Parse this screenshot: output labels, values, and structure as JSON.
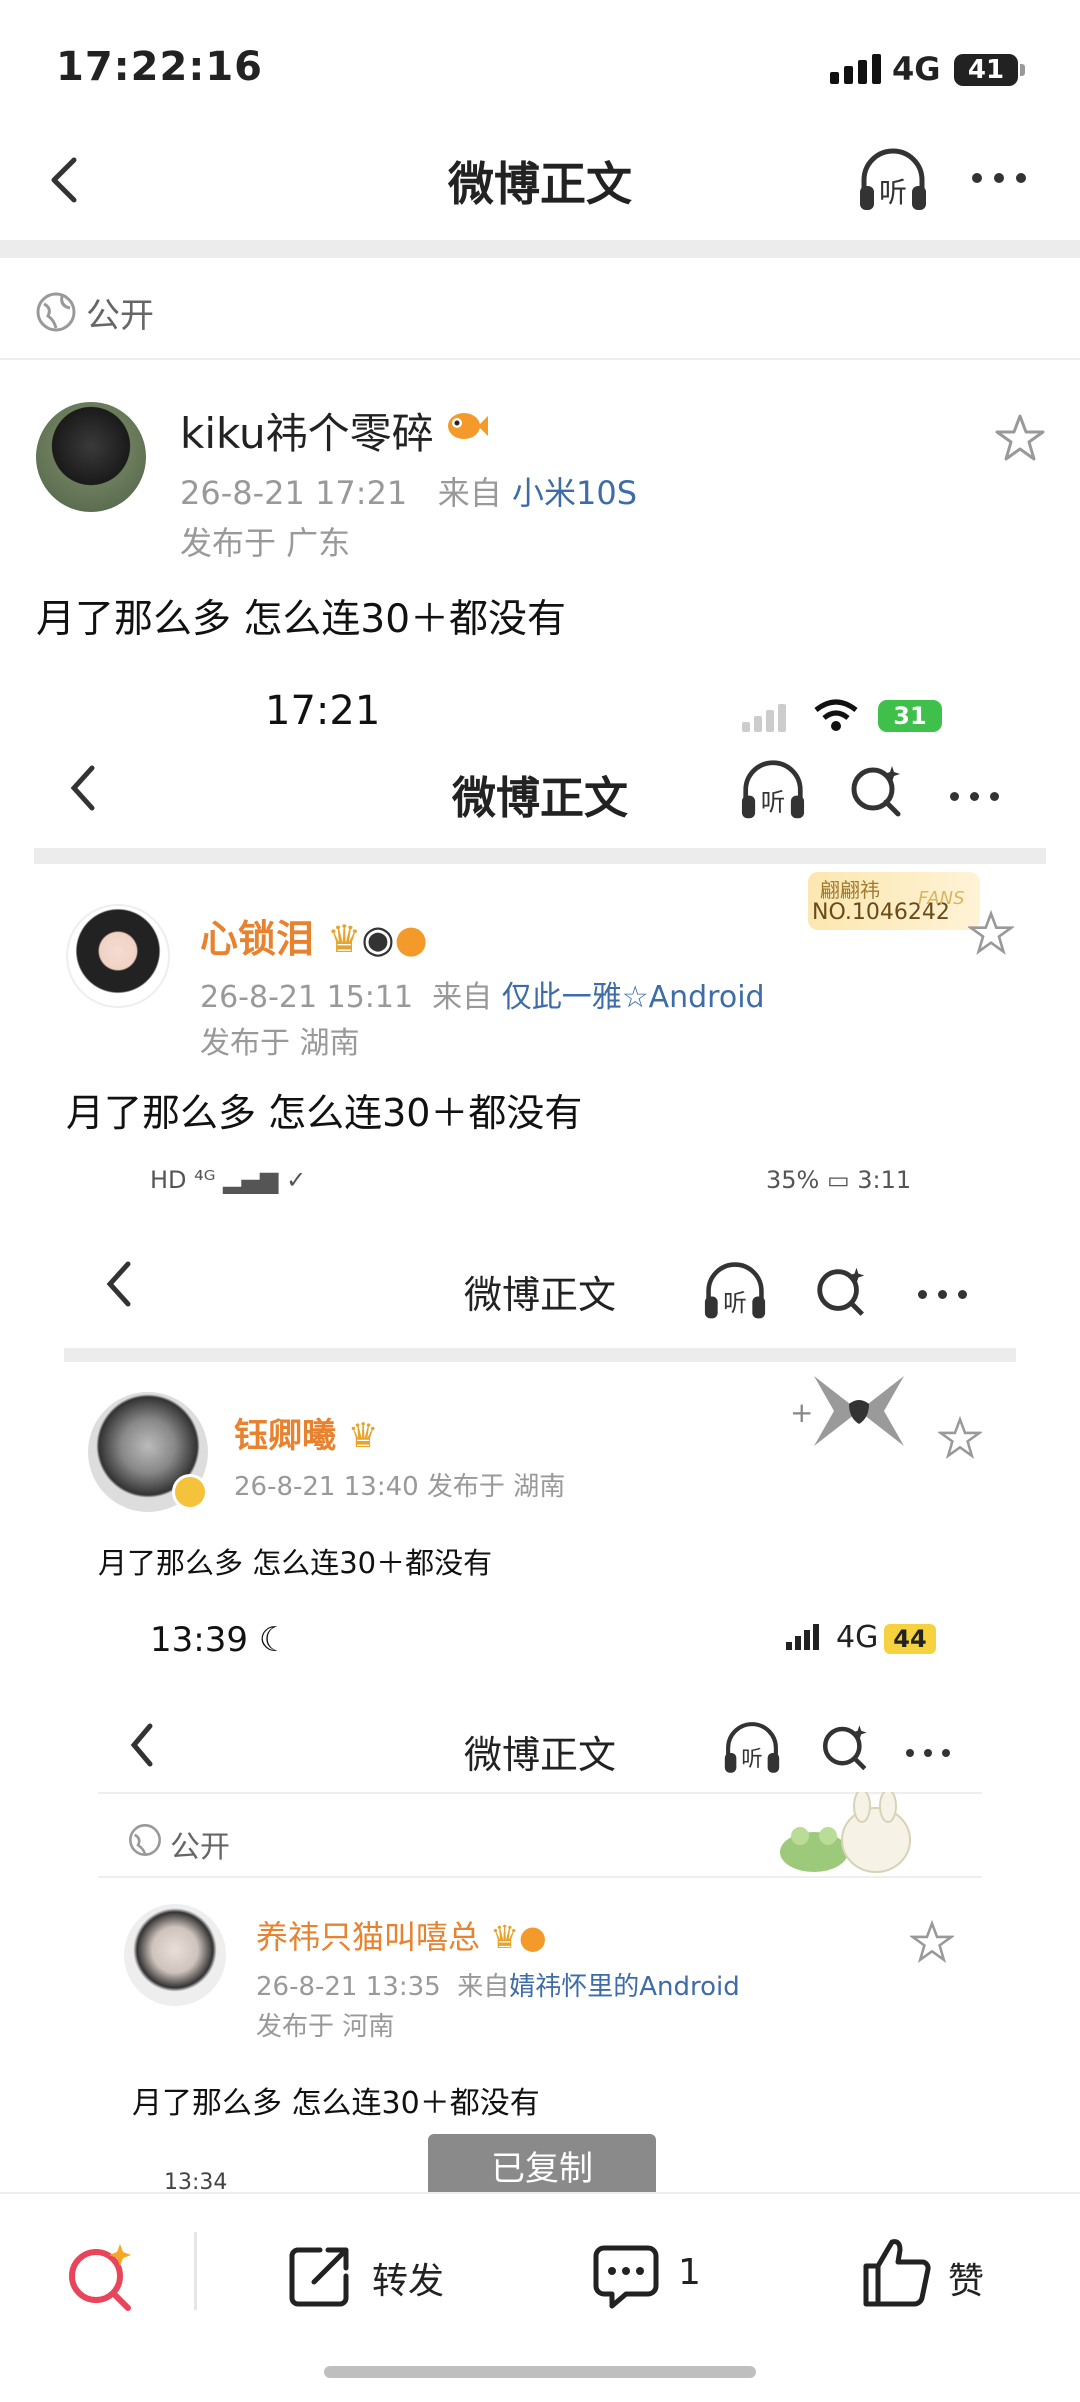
{
  "status_bar": {
    "time": "17:22:16",
    "network": "4G",
    "battery": "41"
  },
  "nav": {
    "title": "微博正文",
    "listen_label": "听"
  },
  "visibility": {
    "label": "公开"
  },
  "post": {
    "username": "kiku祎个零碎",
    "date": "26-8-21 17:21",
    "source_prefix": "来自",
    "source": "小米10S",
    "location": "发布于 广东",
    "text": "月了那么多 怎么连30＋都没有"
  },
  "embed1": {
    "status_time": "17:21",
    "battery": "31",
    "title": "微博正文",
    "listen_label": "听",
    "fans_badge_line1": "翩翩祎",
    "fans_badge_line2": "NO.1046242",
    "fans_badge_tag": "FANS",
    "username": "心锁泪",
    "date": "26-8-21 15:11",
    "source_prefix": "来自",
    "source": "仅此一雅☆Android",
    "location": "发布于 湖南",
    "text": "月了那么多 怎么连30＋都没有"
  },
  "embed2": {
    "status_left": "HD ⁴ᴳ",
    "battery_percent": "35%",
    "status_time": "3:11",
    "title": "微博正文",
    "listen_label": "听",
    "username": "钰卿曦",
    "meta": "26-8-21 13:40   发布于 湖南",
    "text": "月了那么多 怎么连30＋都没有"
  },
  "embed3": {
    "status_time": "13:39",
    "network": "4G",
    "battery": "44",
    "title": "微博正文",
    "listen_label": "听",
    "visibility": "公开",
    "username": "养祎只猫叫嘻总",
    "date": "26-8-21 13:35",
    "source_prefix": "来自",
    "source": "婧祎怀里的Android",
    "location": "发布于 河南",
    "text": "月了那么多 怎么连30＋都没有",
    "cut_time": "13:34"
  },
  "toast": {
    "text": "已复制"
  },
  "toolbar": {
    "repost": "转发",
    "comment_count": "1",
    "like": "赞"
  },
  "colors": {
    "link": "#3d6ca8",
    "vip_name": "#e8822e",
    "meta_gray": "#999999"
  }
}
